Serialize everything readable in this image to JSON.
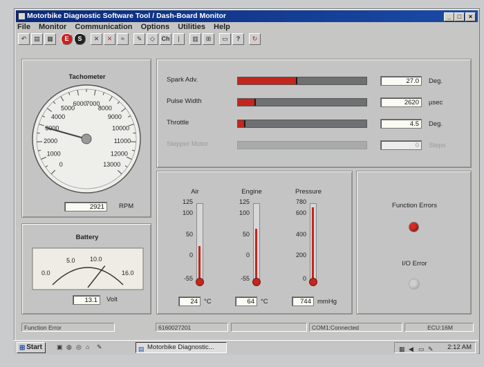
{
  "window": {
    "title": "Motorbike Diagnostic Software Tool / Dash-Board Monitor",
    "controls": [
      "_",
      "□",
      "×"
    ]
  },
  "menu": [
    "File",
    "Monitor",
    "Communication",
    "Options",
    "Utilities",
    "Help"
  ],
  "toolbar": {
    "button_glyphs": [
      "↶",
      "▤",
      "▦",
      "E",
      "S",
      "✕",
      "✕",
      "≈",
      "✎",
      "◇",
      "Ch",
      "|",
      "▥",
      "⊞",
      "▭",
      "?",
      "↻"
    ]
  },
  "tachometer": {
    "label": "Tachometer",
    "scale_labels": [
      "0",
      "1000",
      "2000",
      "3000",
      "4000",
      "5000",
      "6000",
      "7000",
      "8000",
      "9000",
      "10000",
      "11000",
      "12000",
      "13000"
    ],
    "rpm": 2921,
    "rpm_text": "2921",
    "unit": "RPM"
  },
  "battery": {
    "label": "Battery",
    "scale_labels": [
      "0.0",
      "5.0",
      "10.0",
      "16.0"
    ],
    "voltage": 13.1,
    "voltage_text": "13.1",
    "unit": "Volt"
  },
  "engine_params": [
    {
      "name": "Spark Adv.",
      "value": "27.0",
      "unit": "Deg.",
      "fraction": 0.45,
      "enabled": true
    },
    {
      "name": "Pulse Width",
      "value": "2620",
      "unit": "µsec",
      "fraction": 0.13,
      "enabled": true
    },
    {
      "name": "Throttle",
      "value": "4.5",
      "unit": "Deg.",
      "fraction": 0.05,
      "enabled": true
    },
    {
      "name": "Stepper Motor",
      "value": "0",
      "unit": "Steps",
      "fraction": 0,
      "enabled": false
    }
  ],
  "thermometers": [
    {
      "name": "Air",
      "ticks": [
        "125",
        "100",
        "50",
        "0",
        "-55"
      ],
      "value_text": "24",
      "unit": "°C",
      "fraction": 0.44
    },
    {
      "name": "Engine",
      "ticks": [
        "125",
        "100",
        "50",
        "0",
        "-55"
      ],
      "value_text": "64",
      "unit": "°C",
      "fraction": 0.66
    },
    {
      "name": "Pressure",
      "ticks": [
        "780",
        "600",
        "400",
        "200",
        "0"
      ],
      "value_text": "744",
      "unit": "mmHg",
      "fraction": 0.95
    }
  ],
  "errors": {
    "function_errors_label": "Function Errors",
    "function_errors_color": "#d92a22",
    "io_error_label": "I/O Error",
    "io_error_color": "#cfcfcf"
  },
  "status": {
    "message": "Function Error",
    "code": "6160027201",
    "blank": "",
    "connection": "COM1:Connected",
    "ecu": "ECU:16M"
  },
  "taskbar": {
    "start_label": "Start",
    "task_label": "Motorbike Diagnostic...",
    "clock": "2:12 AM"
  }
}
